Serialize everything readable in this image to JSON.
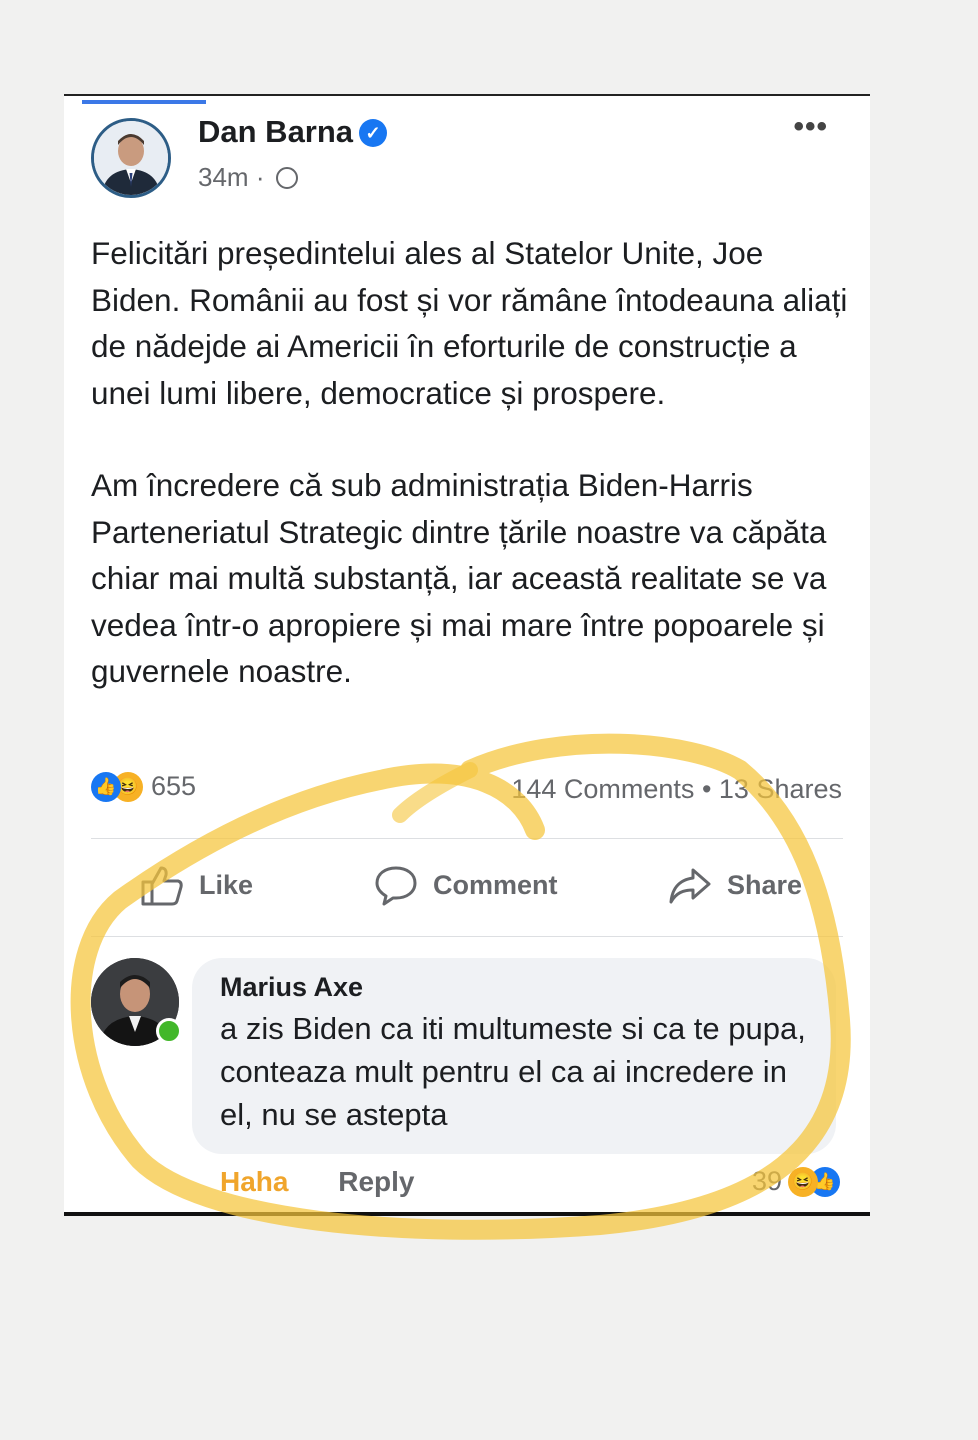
{
  "post": {
    "author": "Dan Barna",
    "time": "34m",
    "separator": "·",
    "paragraph1": "Felicitări președintelui ales al Statelor Unite, Joe Biden. Românii au fost și vor rămâne întodeauna aliați de nădejde ai Americii în eforturile de construcție a unei lumi libere, democratice și prospere.",
    "paragraph2": "Am încredere că sub administrația Biden-Harris Parteneriatul Strategic dintre țările noastre va căpăta chiar mai multă substanță, iar această realitate se va vedea într-o apropiere și mai mare între popoarele și guvernele noastre.",
    "reaction_count": "655",
    "comments_count": "144 Comments",
    "shares_count": "13 Shares",
    "stats_separator": "•"
  },
  "actions": {
    "like_label": "Like",
    "comment_label": "Comment",
    "share_label": "Share"
  },
  "comment": {
    "author": "Marius Axe",
    "text": "a zis Biden ca iti multumeste si ca te pupa, conteaza mult pentru el ca ai incredere in el, nu se astepta",
    "reaction_label": "Haha",
    "reply_label": "Reply",
    "reaction_count": "39"
  },
  "colors": {
    "facebook_blue": "#1877f2",
    "highlight_yellow": "#f5c53a",
    "haha_orange": "#f0a52c",
    "muted_text": "#65676b"
  },
  "icons": [
    "verified-icon",
    "globe-icon",
    "more-icon",
    "like-reaction-icon",
    "haha-reaction-icon",
    "thumbs-up-icon",
    "comment-icon",
    "share-icon"
  ]
}
